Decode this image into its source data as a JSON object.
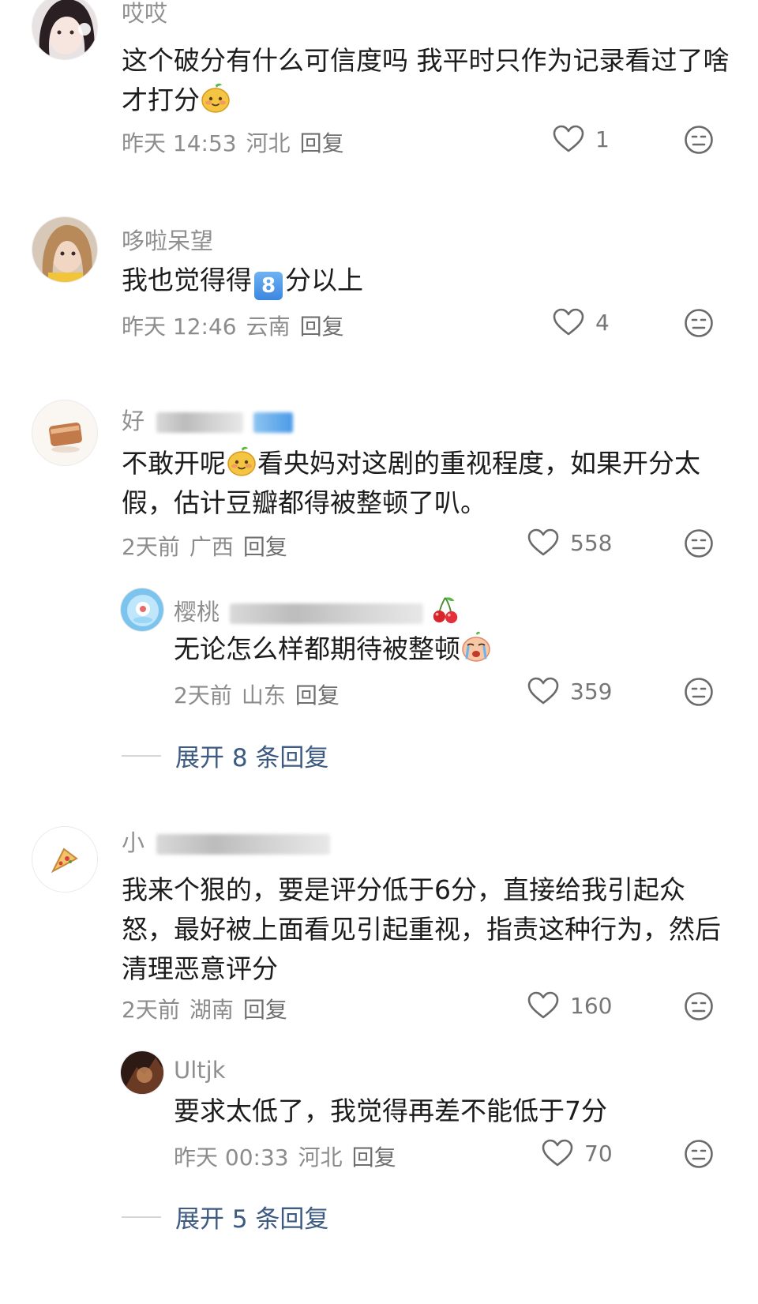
{
  "comments": [
    {
      "username": "哎哎",
      "text": "这个破分有什么可信度吗 我平时只作为记录看过了啥才打分",
      "time": "昨天 14:53",
      "location": "河北",
      "reply_label": "回复",
      "likes": "1"
    },
    {
      "username": "哆啦呆望",
      "text_before": "我也觉得得",
      "badge": "8",
      "text_after": "分以上",
      "time": "昨天 12:46",
      "location": "云南",
      "reply_label": "回复",
      "likes": "4"
    },
    {
      "username": "好",
      "text_a": "不敢开呢",
      "text_b": "看央妈对这剧的重视程度，如果开分太假，估计豆瓣都得被整顿了叭。",
      "time": "2天前",
      "location": "广西",
      "reply_label": "回复",
      "likes": "558",
      "reply": {
        "username": "樱桃",
        "text": "无论怎么样都期待被整顿",
        "time": "2天前",
        "location": "山东",
        "reply_label": "回复",
        "likes": "359"
      },
      "expand_label": "展开 8 条回复"
    },
    {
      "username": "小",
      "text": "我来个狠的，要是评分低于6分，直接给我引起众怒，最好被上面看见引起重视，指责这种行为，然后清理恶意评分",
      "time": "2天前",
      "location": "湖南",
      "reply_label": "回复",
      "likes": "160",
      "reply": {
        "username": "Ultjk",
        "text": "要求太低了，我觉得再差不能低于7分",
        "time": "昨天 00:33",
        "location": "河北",
        "reply_label": "回复",
        "likes": "70"
      },
      "expand_label": "展开 5 条回复"
    }
  ],
  "icons": {
    "like": "heart-outline-icon",
    "dislike": "neutral-face-icon",
    "emoji_a": "smiling-mango-emoji",
    "emoji_b": "crying-face-emoji",
    "emoji_c": "cherries-emoji"
  },
  "colors": {
    "expand_link": "#3c5a82",
    "meta_text": "#8c8c8c",
    "badge_blue": "#3c86e0"
  }
}
